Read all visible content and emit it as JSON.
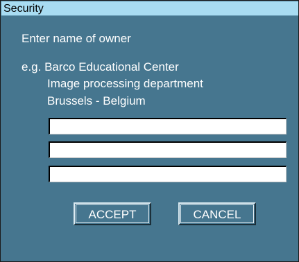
{
  "dialog": {
    "title": "Security",
    "prompt": "Enter name of owner",
    "example": [
      "e.g. Barco Educational Center",
      "Image processing department",
      "Brussels - Belgium"
    ]
  },
  "fields": [
    {
      "value": "",
      "placeholder": ""
    },
    {
      "value": "",
      "placeholder": ""
    },
    {
      "value": "",
      "placeholder": ""
    }
  ],
  "buttons": {
    "accept_label": "ACCEPT",
    "cancel_label": "CANCEL"
  },
  "colors": {
    "dialog_background": "#46768f",
    "titlebar_background": "#a8dcf2",
    "text": "#ffffff",
    "field_background": "#ffffff"
  }
}
